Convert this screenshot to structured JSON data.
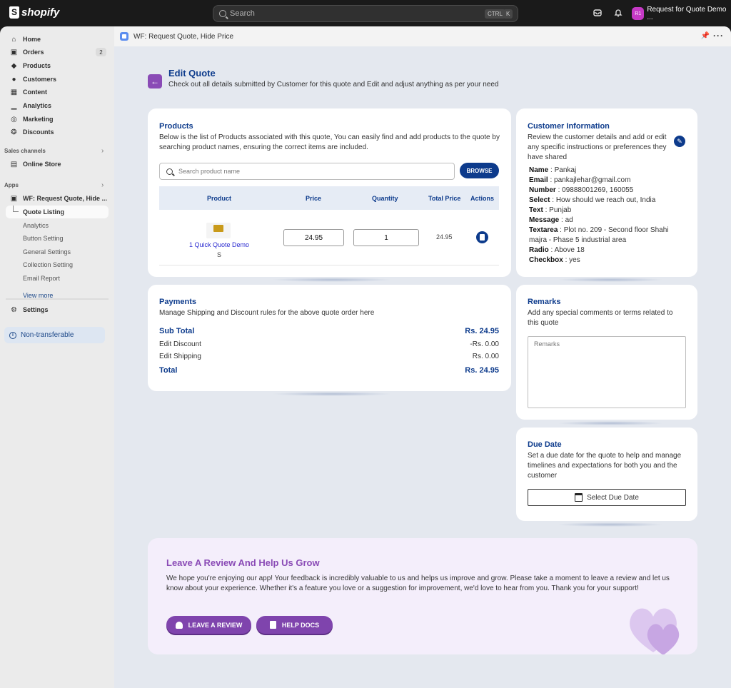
{
  "topbar": {
    "brand": "shopify",
    "search_placeholder": "Search",
    "kbd_ctrl": "CTRL",
    "kbd_k": "K",
    "store_initials": "R1",
    "store_name": "Request for Quote Demo ..."
  },
  "sidebar": {
    "items": [
      {
        "label": "Home",
        "icon": "home-icon"
      },
      {
        "label": "Orders",
        "icon": "orders-icon",
        "badge": "2"
      },
      {
        "label": "Products",
        "icon": "tag-icon"
      },
      {
        "label": "Customers",
        "icon": "person-icon"
      },
      {
        "label": "Content",
        "icon": "content-icon"
      },
      {
        "label": "Analytics",
        "icon": "bar-chart-icon"
      },
      {
        "label": "Marketing",
        "icon": "target-icon"
      },
      {
        "label": "Discounts",
        "icon": "discount-icon"
      }
    ],
    "sales_channels_label": "Sales channels",
    "online_store": "Online Store",
    "apps_label": "Apps",
    "app_name": "WF: Request Quote, Hide ...",
    "app_subitems": [
      "Quote Listing",
      "Analytics",
      "Button Setting",
      "General Settings",
      "Collection Setting",
      "Email Report"
    ],
    "view_more": "View more",
    "settings": "Settings",
    "non_transferable": "Non-transferable"
  },
  "app_header": {
    "title": "WF: Request Quote, Hide Price"
  },
  "page": {
    "title": "Edit Quote",
    "subtitle": "Check out all details submitted by Customer for this quote and Edit and adjust anything as per your need"
  },
  "products": {
    "title": "Products",
    "description": "Below is the list of Products associated with this quote, You can easily find and add products to the quote by searching product names, ensuring the correct items are included.",
    "search_placeholder": "Search product name",
    "browse_label": "BROWSE",
    "columns": [
      "Product",
      "Price",
      "Quantity",
      "Total Price",
      "Actions"
    ],
    "rows": [
      {
        "name": "1 Quick Quote Demo",
        "variant": "S",
        "price": "24.95",
        "quantity": "1",
        "total": "24.95"
      }
    ]
  },
  "customer": {
    "title": "Customer Information",
    "description": "Review the customer details and add or edit any specific instructions or preferences they have shared",
    "fields": [
      {
        "key": "Name",
        "value": "Pankaj"
      },
      {
        "key": "Email",
        "value": "pankajlehar@gmail.com"
      },
      {
        "key": "Number",
        "value": "09888001269, 160055"
      },
      {
        "key": "Select",
        "value": "How should we reach out, India"
      },
      {
        "key": "Text",
        "value": "Punjab"
      },
      {
        "key": "Message",
        "value": "ad"
      },
      {
        "key": "Textarea",
        "value": "Plot no. 209 - Second floor Shahi majra - Phase 5 industrial area"
      },
      {
        "key": "Radio",
        "value": "Above 18"
      },
      {
        "key": "Checkbox",
        "value": "yes"
      }
    ]
  },
  "payments": {
    "title": "Payments",
    "description": "Manage Shipping and Discount rules for the above quote order here",
    "subtotal_label": "Sub Total",
    "subtotal_value": "Rs. 24.95",
    "discount_label": "Edit Discount",
    "discount_value": "-Rs. 0.00",
    "shipping_label": "Edit Shipping",
    "shipping_value": "Rs. 0.00",
    "total_label": "Total",
    "total_value": "Rs. 24.95"
  },
  "remarks": {
    "title": "Remarks",
    "description": "Add any special comments or terms related to this quote",
    "placeholder": "Remarks"
  },
  "due_date": {
    "title": "Due Date",
    "description": "Set a due date for the quote to help and manage timelines and expectations for both you and the customer",
    "button_label": "Select Due Date"
  },
  "review": {
    "title": "Leave A Review And Help Us Grow",
    "text": "We hope you're enjoying our app! Your feedback is incredibly valuable to us and helps us improve and grow. Please take a moment to leave a review and let us know about your experience. Whether it's a feature you love or a suggestion for improvement, we'd love to hear from you. Thank you for your support!",
    "leave_review_label": "LEAVE A REVIEW",
    "help_docs_label": "HELP DOCS"
  },
  "colors": {
    "accent": "#0d3b8c",
    "purple": "#8a4bb6",
    "background": "#e4e8ef"
  }
}
